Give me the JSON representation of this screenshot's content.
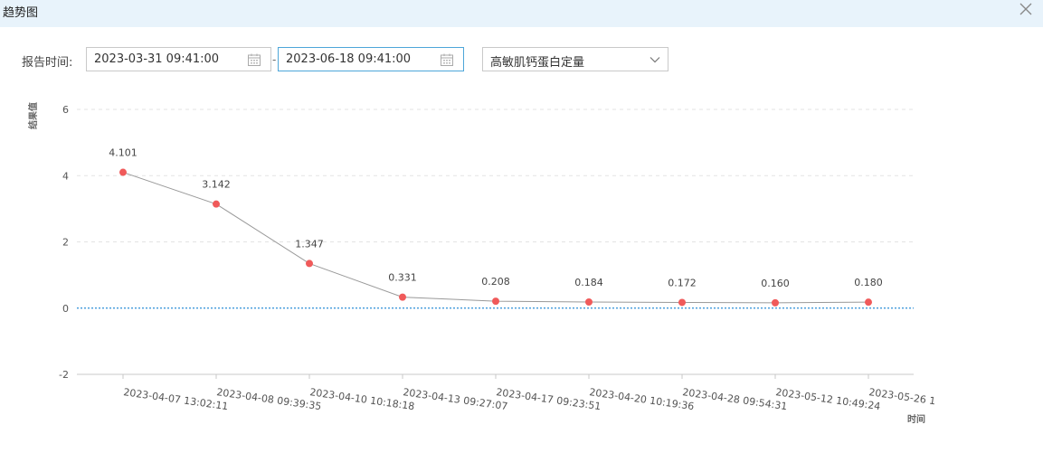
{
  "window": {
    "title": "趋势图",
    "close_icon": "close-icon"
  },
  "filters": {
    "label": "报告时间:",
    "start": "2023-03-31 09:41:00",
    "separator": "-",
    "end": "2023-06-18 09:41:00",
    "item": "高敏肌钙蛋白定量",
    "calendar_icon": "calendar-icon",
    "dropdown_icon": "chevron-down-icon"
  },
  "chart_data": {
    "type": "line",
    "xlabel": "时间",
    "ylabel": "结果值",
    "ylim": [
      -2,
      6
    ],
    "yticks": [
      "-2",
      "0",
      "2",
      "4",
      "6"
    ],
    "grid": "horizontal dashed",
    "reference_line": 0,
    "categories": [
      "2023-04-07 13:02:11",
      "2023-04-08 09:39:35",
      "2023-04-10 10:18:18",
      "2023-04-13 09:27:07",
      "2023-04-17 09:23:51",
      "2023-04-20 10:19:36",
      "2023-04-28 09:54:31",
      "2023-05-12 10:49:24",
      "2023-05-26 1"
    ],
    "values": [
      4.101,
      3.142,
      1.347,
      0.331,
      0.208,
      0.184,
      0.172,
      0.16,
      0.18
    ],
    "value_labels": [
      "4.101",
      "3.142",
      "1.347",
      "0.331",
      "0.208",
      "0.184",
      "0.172",
      "0.160",
      "0.180"
    ],
    "colors": {
      "line": "#999999",
      "point": "#f05a5a",
      "reference": "#2b8fd6",
      "grid": "#e3e3e3"
    }
  }
}
